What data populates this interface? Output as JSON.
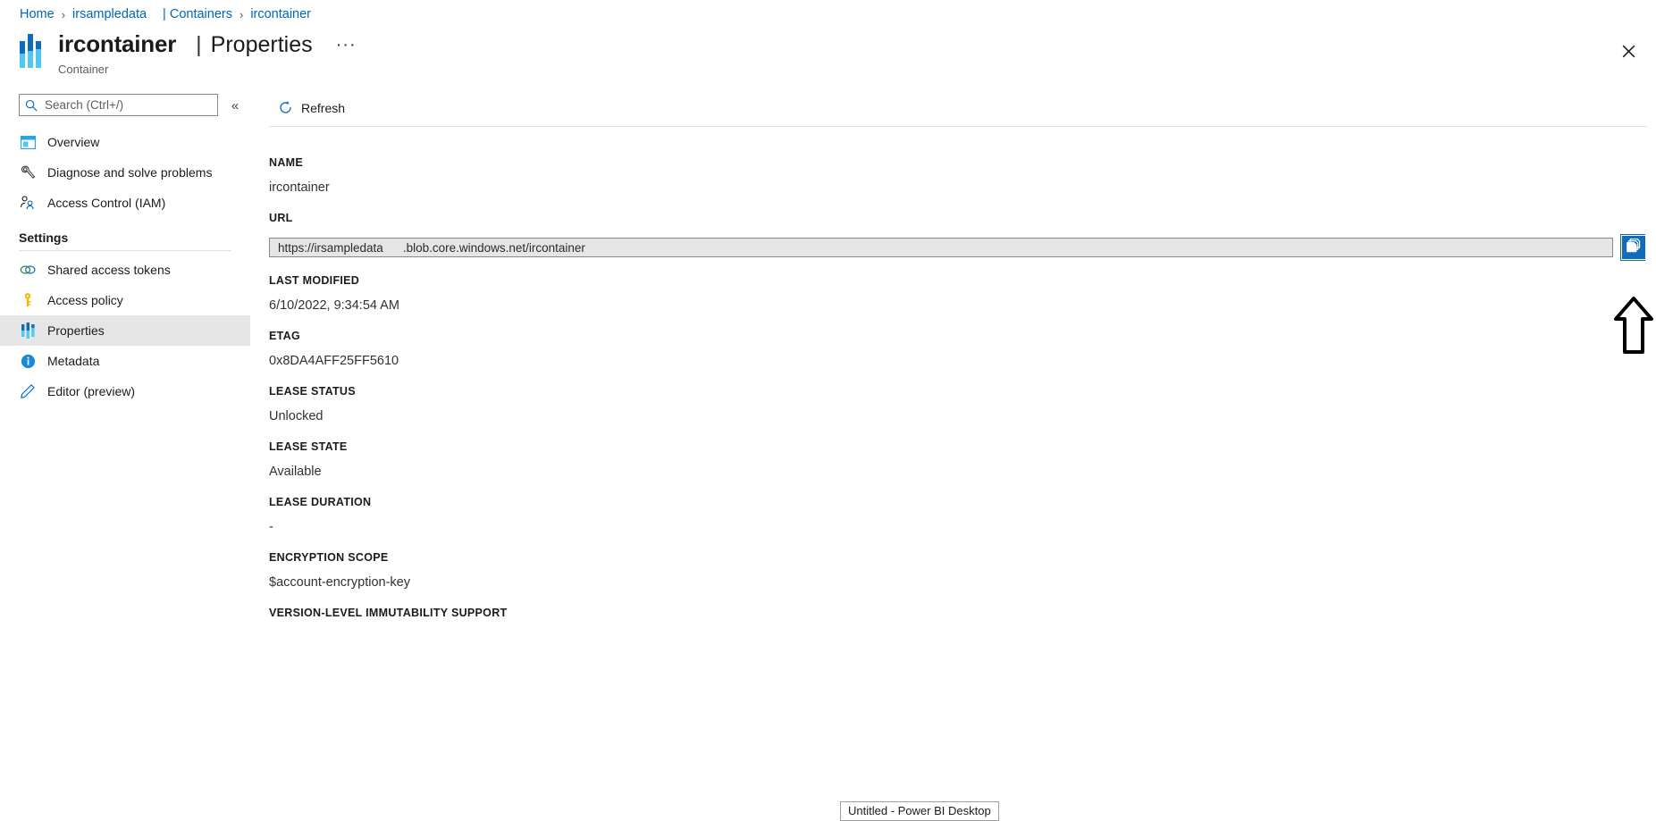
{
  "breadcrumb": {
    "items": [
      {
        "label": "Home",
        "type": "link"
      },
      {
        "label": "irsampledata",
        "type": "link"
      },
      {
        "label": "| Containers",
        "type": "link"
      },
      {
        "label": "ircontainer",
        "type": "link"
      }
    ],
    "separator": "›"
  },
  "header": {
    "title": "ircontainer",
    "separator": "|",
    "section": "Properties",
    "ellipsis": "···",
    "subtitle": "Container",
    "close_label": "✕",
    "icon": "container-icon"
  },
  "sidebar": {
    "search": {
      "placeholder": "Search (Ctrl+/)",
      "value": "",
      "icon": "search-icon"
    },
    "collapse": {
      "label": "«",
      "icon": "chevron-double-left-icon"
    },
    "top_items": [
      {
        "label": "Overview",
        "icon": "overview-icon",
        "active": false
      },
      {
        "label": "Diagnose and solve problems",
        "icon": "wrench-icon",
        "active": false
      },
      {
        "label": "Access Control (IAM)",
        "icon": "access-control-icon",
        "active": false
      }
    ],
    "group_label": "Settings",
    "settings_items": [
      {
        "label": "Shared access tokens",
        "icon": "link-chain-icon",
        "active": false
      },
      {
        "label": "Access policy",
        "icon": "key-icon",
        "active": false
      },
      {
        "label": "Properties",
        "icon": "container-bars-icon",
        "active": true
      },
      {
        "label": "Metadata",
        "icon": "info-icon",
        "active": false
      },
      {
        "label": "Editor (preview)",
        "icon": "pencil-icon",
        "active": false
      }
    ]
  },
  "toolbar": {
    "refresh_label": "Refresh",
    "refresh_icon": "refresh-icon"
  },
  "properties": [
    {
      "label": "NAME",
      "value": "ircontainer",
      "type": "text"
    },
    {
      "label": "URL",
      "type": "url",
      "value_prefix": "https://irsampledata",
      "value_suffix": ".blob.core.windows.net/ircontainer",
      "copy_icon": "copy-icon"
    },
    {
      "label": "LAST MODIFIED",
      "value": "6/10/2022, 9:34:54 AM",
      "type": "text"
    },
    {
      "label": "ETAG",
      "value": "0x8DA4AFF25FF5610",
      "type": "text"
    },
    {
      "label": "LEASE STATUS",
      "value": "Unlocked",
      "type": "text"
    },
    {
      "label": "LEASE STATE",
      "value": "Available",
      "type": "text"
    },
    {
      "label": "LEASE DURATION",
      "value": "-",
      "type": "text"
    },
    {
      "label": "ENCRYPTION SCOPE",
      "value": "$account-encryption-key",
      "type": "text"
    },
    {
      "label": "VERSION-LEVEL IMMUTABILITY SUPPORT",
      "value": "",
      "type": "text"
    }
  ],
  "annotation": {
    "arrow": "up-arrow-annotation"
  },
  "taskbar": {
    "tooltip": "Untitled - Power BI Desktop"
  },
  "colors": {
    "link": "#0067b8",
    "accent": "#0f6cbd",
    "accent_light": "#50c8f0",
    "active_row": "#e6e6e6",
    "text": "#1b1b1b",
    "text_muted": "#5d5d5d"
  }
}
